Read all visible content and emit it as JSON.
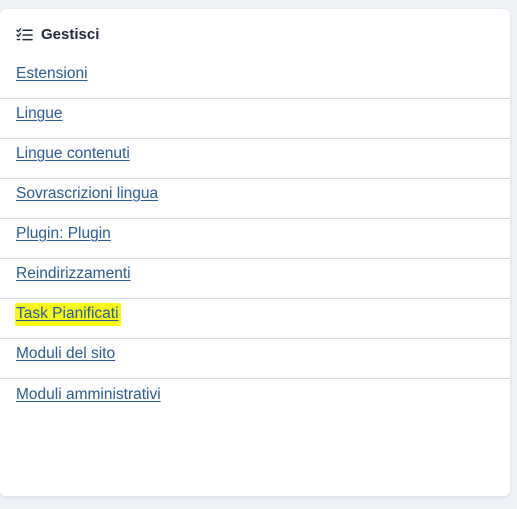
{
  "panel": {
    "title": "Gestisci",
    "icon": "list-check-icon"
  },
  "links": [
    {
      "label": "Estensioni"
    },
    {
      "label": "Lingue"
    },
    {
      "label": "Lingue contenuti"
    },
    {
      "label": "Sovrascrizioni lingua"
    },
    {
      "label": "Plugin: Plugin"
    },
    {
      "label": "Reindirizzamenti"
    },
    {
      "label": "Task Pianificati",
      "highlighted": true
    },
    {
      "label": "Moduli del sito"
    },
    {
      "label": "Moduli amministrativi"
    }
  ],
  "colors": {
    "link": "#2a5b92",
    "highlight": "#f7f71a",
    "divider": "#cdd8e6",
    "background": "#eef1f6"
  }
}
